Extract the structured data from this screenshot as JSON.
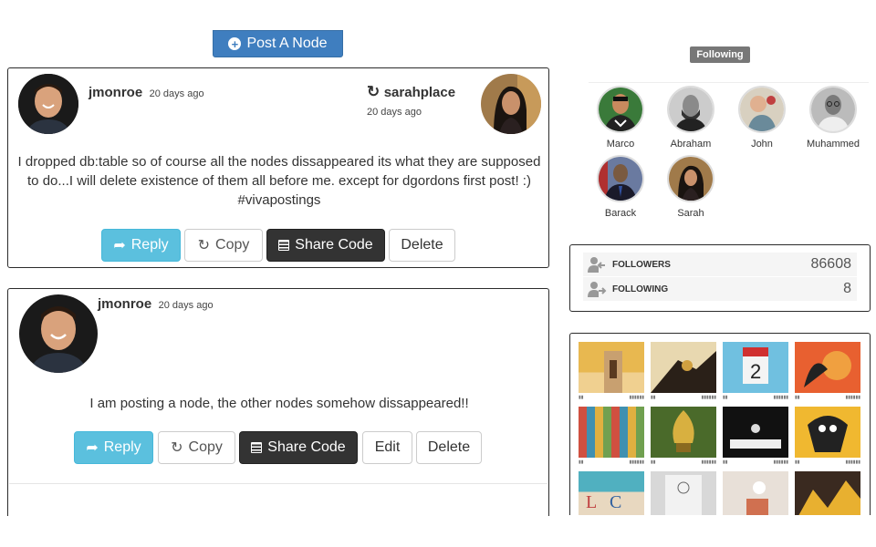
{
  "toolbar": {
    "post_label": "Post A Node",
    "post_icon": "plus-circle-icon"
  },
  "posts": [
    {
      "author": "jmonroe",
      "time": "20 days ago",
      "repost_user": "sarahplace",
      "repost_time": "20 days ago",
      "text": "I dropped db:table so of course all the nodes dissappeared its what they are supposed to do...I will delete existence of them all before me. except for dgordons first post! :) #vivapostings",
      "buttons": {
        "reply": "Reply",
        "copy": "Copy",
        "share": "Share Code",
        "delete": "Delete"
      }
    },
    {
      "author": "jmonroe",
      "time": "20 days ago",
      "text": "I am posting a node, the other nodes somehow dissappeared!!",
      "buttons": {
        "reply": "Reply",
        "copy": "Copy",
        "share": "Share Code",
        "edit": "Edit",
        "delete": "Delete"
      }
    }
  ],
  "sidebar": {
    "following_badge": "Following",
    "friends": [
      {
        "name": "Marco"
      },
      {
        "name": "Abraham"
      },
      {
        "name": "John"
      },
      {
        "name": "Muhammed"
      },
      {
        "name": "Barack"
      },
      {
        "name": "Sarah"
      }
    ],
    "stats": [
      {
        "label": "FOLLOWERS",
        "value": "86608"
      },
      {
        "label": "FOLLOWING",
        "value": "8"
      }
    ]
  },
  "colors": {
    "primary": "#3f7ebf",
    "reply": "#5bc0de",
    "dark": "#333333",
    "badge": "#777777"
  }
}
